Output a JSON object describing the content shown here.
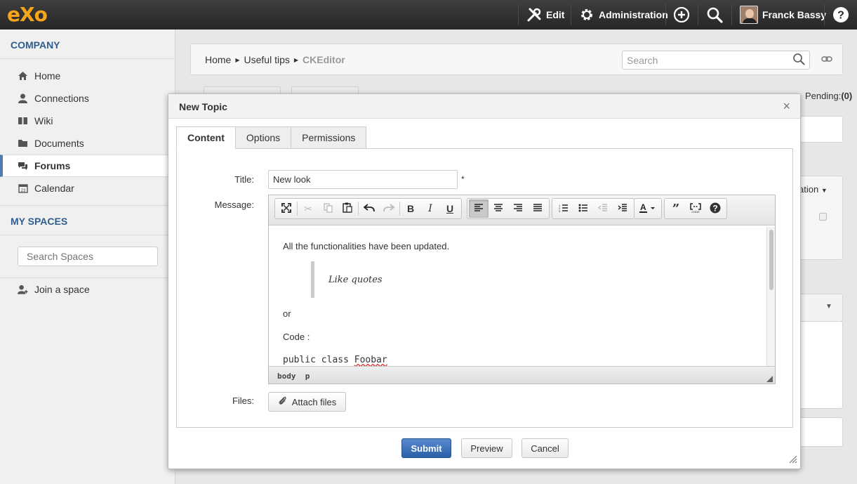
{
  "topbar": {
    "logo": "eXo",
    "edit_label": "Edit",
    "admin_label": "Administration",
    "user_name": "Franck Bassy"
  },
  "sidebar": {
    "company_heading": "COMPANY",
    "items": [
      {
        "label": "Home"
      },
      {
        "label": "Connections"
      },
      {
        "label": "Wiki"
      },
      {
        "label": "Documents"
      },
      {
        "label": "Forums"
      },
      {
        "label": "Calendar"
      }
    ],
    "spaces_heading": "MY SPACES",
    "spaces_search_placeholder": "Search Spaces",
    "join_label": "Join a space"
  },
  "page": {
    "breadcrumb": [
      "Home",
      "Useful tips",
      "CKEditor"
    ],
    "search_placeholder": "Search",
    "pending_label": "Pending:",
    "pending_count": "(0)",
    "dropdown_label": "ation"
  },
  "modal": {
    "title": "New Topic",
    "tabs": [
      "Content",
      "Options",
      "Permissions"
    ],
    "title_label": "Title:",
    "title_value": "New look",
    "required_mark": "*",
    "message_label": "Message:",
    "files_label": "Files:",
    "attach_label": "Attach files",
    "editor": {
      "paragraph1": "All the functionalities have been updated.",
      "quote": "Like quotes",
      "paragraph2": "or",
      "paragraph3": "Code :",
      "code_prefix": "public class ",
      "code_word": "Foobar",
      "path": "body  p"
    },
    "buttons": {
      "submit": "Submit",
      "preview": "Preview",
      "cancel": "Cancel"
    }
  },
  "colors": {
    "brand": "#f7a51b",
    "heading": "#2f5e8e",
    "primary_button": "#2a5fa8"
  }
}
